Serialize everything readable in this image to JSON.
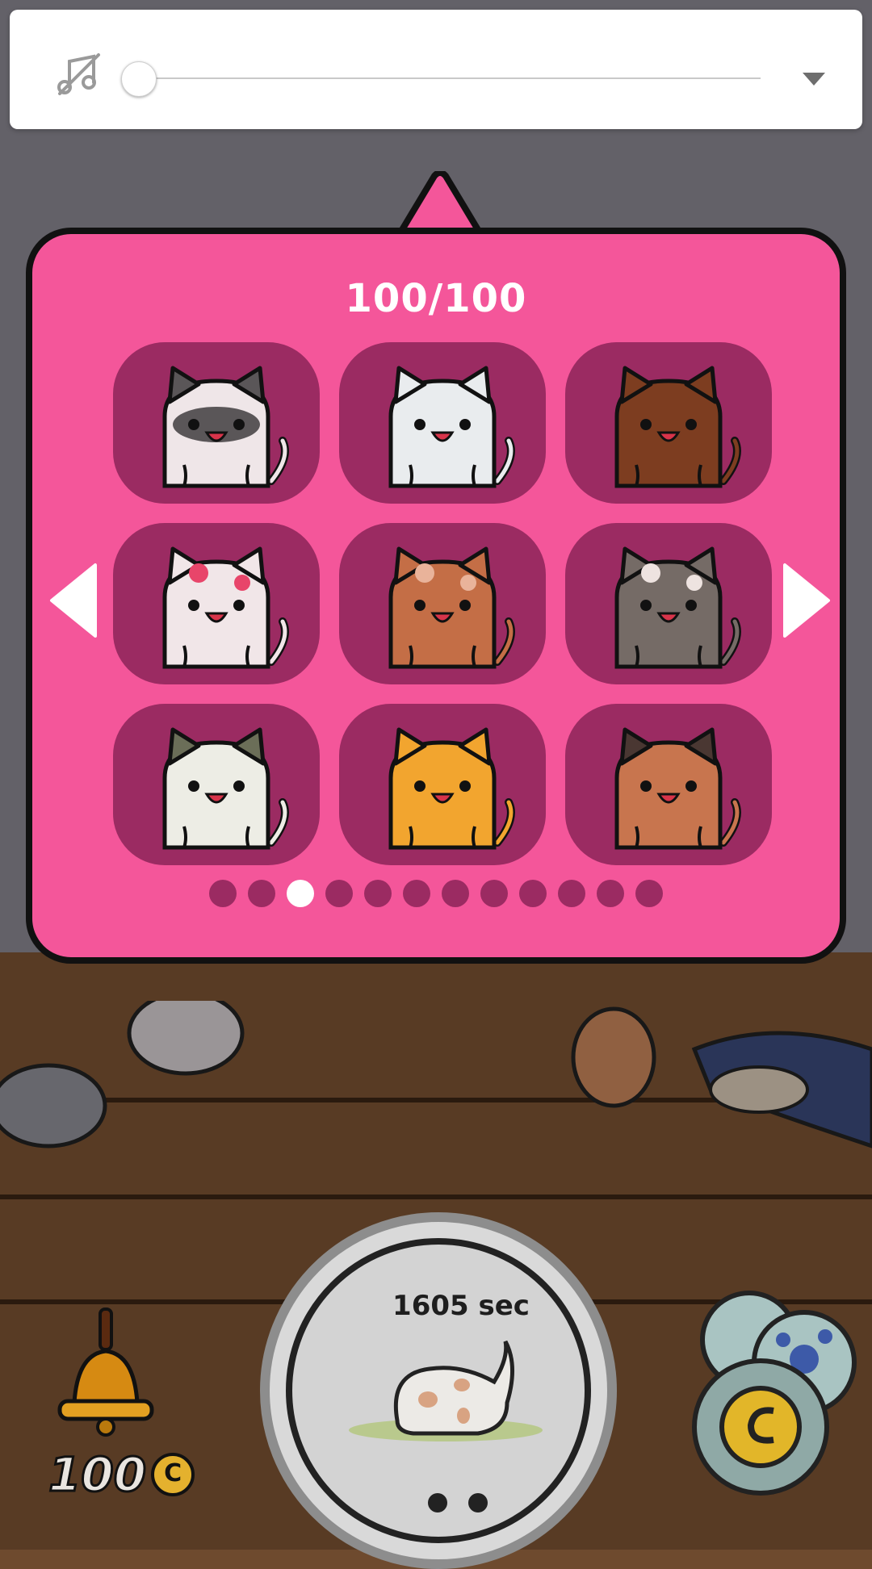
{
  "volume": {
    "icon": "music-off-icon",
    "level": 0,
    "expand_icon": "chevron-down-icon"
  },
  "collection": {
    "count": "100/100",
    "cats": [
      {
        "name": "siamese-cat",
        "body": "#efe6e8",
        "mask": "#5a5658",
        "ears": "#5a5658"
      },
      {
        "name": "white-cat",
        "body": "#e9ecee",
        "mask": "none",
        "ears": "#e9ecee"
      },
      {
        "name": "brown-cat",
        "body": "#7d3d20",
        "mask": "none",
        "ears": "#7d3d20"
      },
      {
        "name": "pink-spotted-cat",
        "body": "#f1e6e8",
        "mask": "none",
        "ears": "#f1e6e8",
        "spots": "#e8456a"
      },
      {
        "name": "ginger-cat",
        "body": "#c46e46",
        "mask": "none",
        "ears": "#c46e46",
        "spots": "#e9b39a"
      },
      {
        "name": "grey-patched-cat",
        "body": "#756b66",
        "mask": "none",
        "ears": "#756b66",
        "spots": "#eee3e0"
      },
      {
        "name": "olive-cat",
        "body": "#edede5",
        "mask": "none",
        "ears": "#6b6e58"
      },
      {
        "name": "orange-tabby-cat",
        "body": "#f2a52f",
        "mask": "none",
        "ears": "#f2a52f"
      },
      {
        "name": "calico-cat",
        "body": "#c8754e",
        "mask": "none",
        "ears": "#4a3732"
      }
    ],
    "pages": 12,
    "active_page": 3,
    "prev_icon": "arrow-left-icon",
    "next_icon": "arrow-right-icon"
  },
  "hud": {
    "coins": "100",
    "coin_symbol": "C",
    "timer": "1605 sec",
    "bell_icon": "bell-icon",
    "shop_icon": "coin-shop-icon"
  },
  "colors": {
    "popup_bg": "#f4569a",
    "cell_bg": "#9b2b62",
    "dot_active": "#ffffff"
  }
}
